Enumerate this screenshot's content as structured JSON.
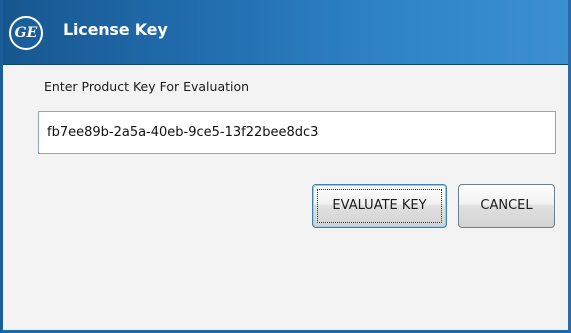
{
  "window": {
    "title": "License Key",
    "logo_text": "GE"
  },
  "form": {
    "prompt_label": "Enter Product Key For Evaluation",
    "product_key_value": "fb7ee89b-2a5a-40eb-9ce5-13f22bee8dc3"
  },
  "buttons": {
    "evaluate_label": "EVALUATE KEY",
    "cancel_label": "CANCEL"
  },
  "colors": {
    "titlebar_dark": "#17578f",
    "titlebar_light": "#3b8fd2",
    "dialog_background": "#f3f3f3"
  }
}
